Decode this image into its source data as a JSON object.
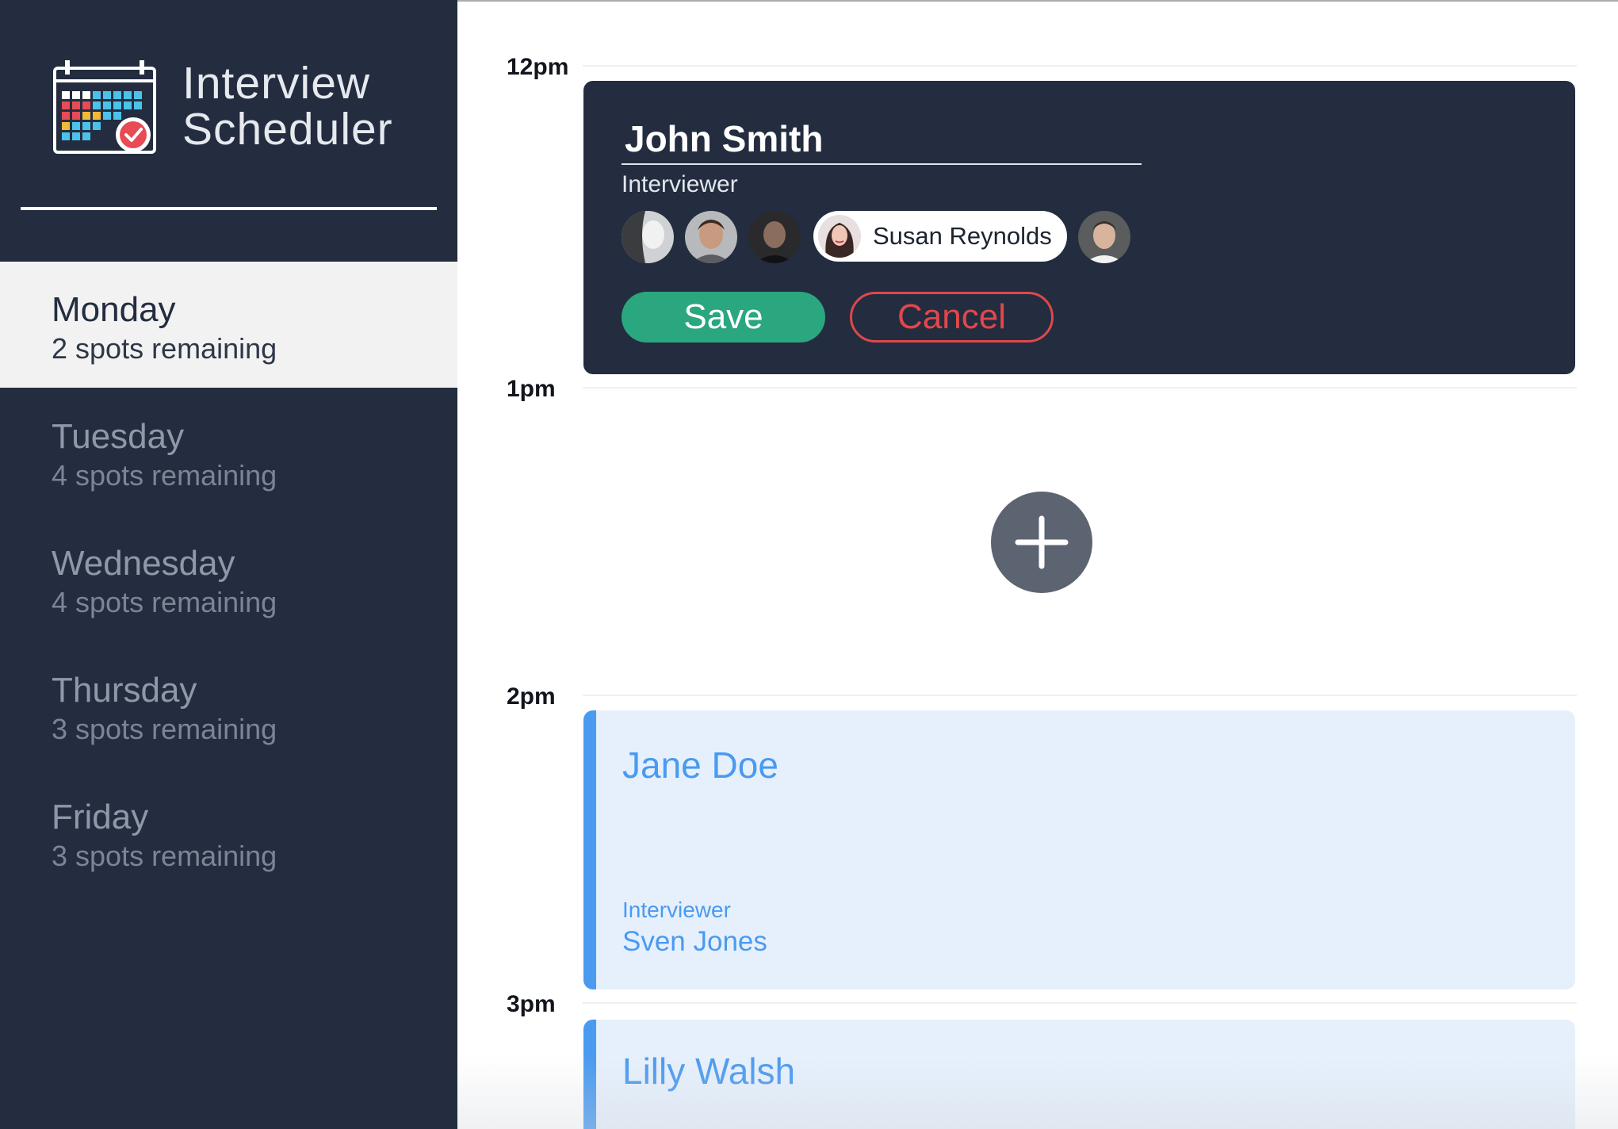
{
  "app": {
    "title_line1": "Interview",
    "title_line2": "Scheduler"
  },
  "sidebar": {
    "days": [
      {
        "name": "Monday",
        "spots": "2 spots remaining",
        "active": true
      },
      {
        "name": "Tuesday",
        "spots": "4 spots remaining",
        "active": false
      },
      {
        "name": "Wednesday",
        "spots": "4 spots remaining",
        "active": false
      },
      {
        "name": "Thursday",
        "spots": "3 spots remaining",
        "active": false
      },
      {
        "name": "Friday",
        "spots": "3 spots remaining",
        "active": false
      }
    ]
  },
  "schedule": {
    "hours": [
      "12pm",
      "1pm",
      "2pm",
      "3pm"
    ],
    "editor": {
      "student_name": "John Smith",
      "section_label": "Interviewer",
      "selected_interviewer": "Susan Reynolds",
      "save_label": "Save",
      "cancel_label": "Cancel"
    },
    "add_icon": "plus-icon",
    "appointments": [
      {
        "student": "Jane Doe",
        "interviewer_label": "Interviewer",
        "interviewer": "Sven Jones"
      },
      {
        "student": "Lilly Walsh"
      }
    ]
  },
  "colors": {
    "sidebar_bg": "#232d3f",
    "save_green": "#2aa77e",
    "cancel_red": "#e1474b",
    "appointment_blue": "#4a9af0",
    "appointment_bg": "#e6f0fc"
  }
}
